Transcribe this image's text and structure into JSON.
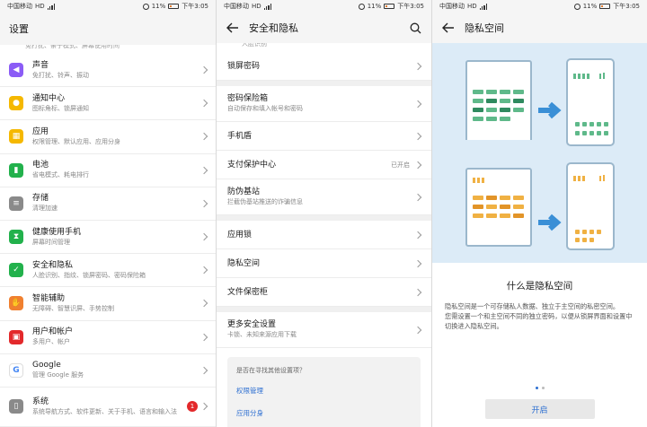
{
  "status": {
    "carrier": "中国移动",
    "hd": "HD",
    "battery_pct": "11%",
    "time": "下午3:05"
  },
  "screens": [
    {
      "title": "设置",
      "truncated_top": "免打扰、亲子模式、屏幕使用时间",
      "items": [
        {
          "label": "声音",
          "sub": "免打扰、铃声、振动",
          "icon": "sound-icon",
          "color": "#8b5cf6"
        },
        {
          "label": "通知中心",
          "sub": "图标角标、锁屏通知",
          "icon": "bell-icon",
          "color": "#f5b800"
        },
        {
          "label": "应用",
          "sub": "权限管理、默认应用、应用分身",
          "icon": "apps-icon",
          "color": "#f5b800"
        },
        {
          "label": "电池",
          "sub": "省电模式、耗电排行",
          "icon": "battery-icon",
          "color": "#22b14c"
        },
        {
          "label": "存储",
          "sub": "清理加速",
          "icon": "storage-icon",
          "color": "#8a8a8a"
        },
        {
          "label": "健康使用手机",
          "sub": "屏幕时间管理",
          "icon": "hourglass-icon",
          "color": "#22b14c"
        },
        {
          "label": "安全和隐私",
          "sub": "人脸识别、指纹、锁屏密码、密码保险箱",
          "icon": "shield-icon",
          "color": "#22b14c"
        },
        {
          "label": "智能辅助",
          "sub": "无障碍、智慧识屏、手势控制",
          "icon": "hand-icon",
          "color": "#f08030"
        },
        {
          "label": "用户和帐户",
          "sub": "多用户、帐户",
          "icon": "user-icon",
          "color": "#e3292b"
        },
        {
          "label": "Google",
          "sub": "管理 Google 服务",
          "icon": "google-icon",
          "color": "#ffffff"
        },
        {
          "label": "系统",
          "sub": "系统导航方式、软件更新、关于手机、语言和输入法",
          "icon": "system-icon",
          "color": "#8a8a8a",
          "badge": "1"
        }
      ]
    },
    {
      "title": "安全和隐私",
      "truncated_top": "人脸识别",
      "groups": [
        [
          {
            "label": "锁屏密码",
            "sub": "",
            "value": ""
          }
        ],
        [
          {
            "label": "密码保险箱",
            "sub": "自动保存和填入帐号和密码",
            "value": ""
          },
          {
            "label": "手机盾",
            "sub": "",
            "value": ""
          },
          {
            "label": "支付保护中心",
            "sub": "",
            "value": "已开启"
          },
          {
            "label": "防伪基站",
            "sub": "拦截伪基站推送的诈骗信息",
            "value": ""
          }
        ],
        [
          {
            "label": "应用锁",
            "sub": "",
            "value": ""
          },
          {
            "label": "隐私空间",
            "sub": "",
            "value": ""
          },
          {
            "label": "文件保密柜",
            "sub": "",
            "value": ""
          }
        ],
        [
          {
            "label": "更多安全设置",
            "sub": "卡锁、未知来源应用下载",
            "value": ""
          }
        ]
      ],
      "suggest": {
        "question": "是否在寻找其他设置项？",
        "links": [
          "权限管理",
          "应用分身"
        ]
      }
    },
    {
      "title": "隐私空间",
      "heading": "什么是隐私空间",
      "desc1": "隐私空间是一个可存储私人数据、独立于主空间的私密空间。",
      "desc2": "您需设置一个和主空间不同的独立密码，以便从锁屏界面和设置中切换进入隐私空间。",
      "button": "开启",
      "page_indicator": {
        "current": 1,
        "total": 2
      }
    }
  ]
}
